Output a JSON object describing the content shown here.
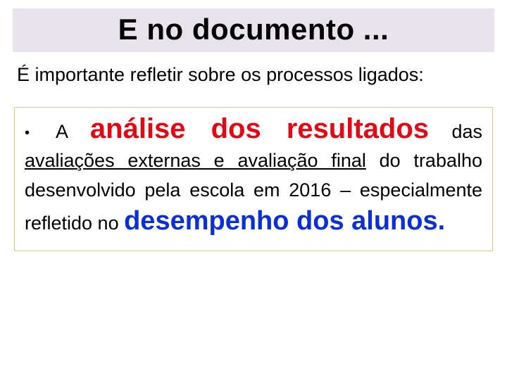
{
  "title": "E no documento ...",
  "intro": "É importante refletir sobre os processos ligados:",
  "bullet": {
    "marker": "•",
    "prefix": "A",
    "highlight_red": "análise dos resultados",
    "suffix": "das"
  },
  "paragraph": {
    "underlined": "avaliações externas e avaliação final",
    "after_underlined": " do trabalho desenvolvido pela escola em 2016 – especialmente refletido no ",
    "highlight_blue": "desempenho dos alunos."
  }
}
